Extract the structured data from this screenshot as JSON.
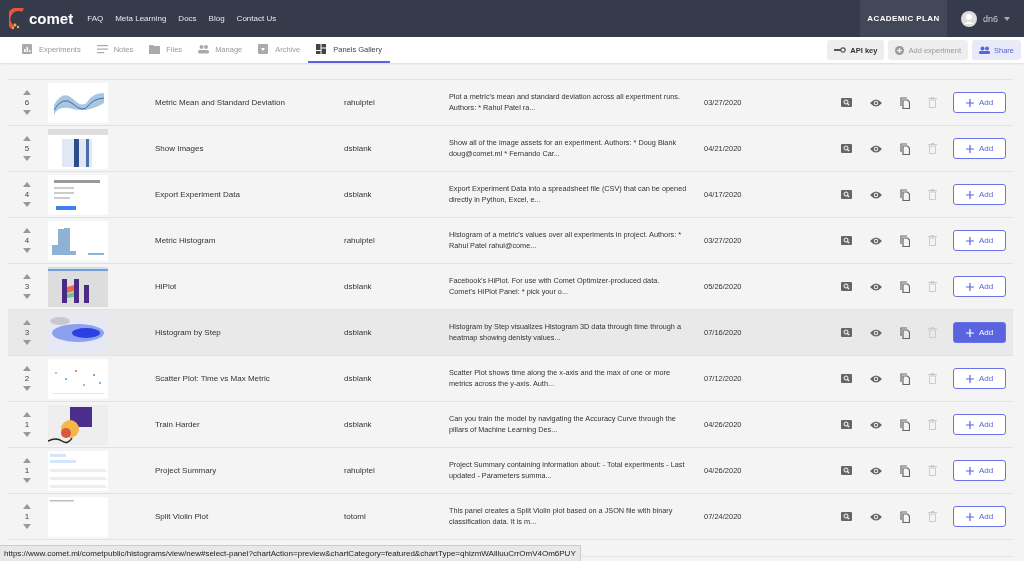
{
  "header": {
    "logo": "comet",
    "nav": [
      "FAQ",
      "Meta Learning",
      "Docs",
      "Blog",
      "Contact Us"
    ],
    "plan": "ACADEMIC PLAN",
    "user": "dn6"
  },
  "tabs": [
    {
      "label": "Experiments",
      "selected": false
    },
    {
      "label": "Notes",
      "selected": false
    },
    {
      "label": "Files",
      "selected": false
    },
    {
      "label": "Manage",
      "selected": false
    },
    {
      "label": "Archive",
      "selected": false
    },
    {
      "label": "Panels Gallery",
      "selected": true
    }
  ],
  "toolbar": {
    "api_key": "API key",
    "add_experiment": {
      "label": "Add experiment",
      "disabled": true
    },
    "share": "Share"
  },
  "panels": [
    {
      "votes": "6",
      "name": "Metric Mean and Standard Deviation",
      "author": "rahulptel",
      "description": "Plot a metric's mean and standard deviation across all experiment runs. Authors: * Rahul Patel ra...",
      "date": "03/27/2020",
      "add": "Add",
      "selected": false
    },
    {
      "votes": "5",
      "name": "Show Images",
      "author": "dsblank",
      "description": "Show all of the image assets for an experiment. Authors: * Doug Blank doug@comet.ml * Fernando Car...",
      "date": "04/21/2020",
      "add": "Add",
      "selected": false
    },
    {
      "votes": "4",
      "name": "Export Experiment Data",
      "author": "dsblank",
      "description": "Export Experiment Data into a spreadsheet file (CSV) that can be opened directly in Python, Excel, e...",
      "date": "04/17/2020",
      "add": "Add",
      "selected": false
    },
    {
      "votes": "4",
      "name": "Metric Histogram",
      "author": "rahulptel",
      "description": "Histogram of a metric's values over all experiments in project. Authors: * Rahul Patel rahul@come...",
      "date": "03/27/2020",
      "add": "Add",
      "selected": false
    },
    {
      "votes": "3",
      "name": "HiPlot",
      "author": "dsblank",
      "description": "Facebook's HiPlot. For use with Comet Optimizer-produced data. Comet's HiPlot Panel: * pick your o...",
      "date": "05/26/2020",
      "add": "Add",
      "selected": false
    },
    {
      "votes": "3",
      "name": "Histogram by Step",
      "author": "dsblank",
      "description": "Histogram by Step visualizes Histogram 3D data through time through a heatmap showing denisty values...",
      "date": "07/16/2020",
      "add": "Add",
      "selected": true
    },
    {
      "votes": "2",
      "name": "Scatter Plot: Time vs Max Metric",
      "author": "dsblank",
      "description": "Scatter Plot shows time along the x-axis and the max of one or more metrics across the y-axis. Auth...",
      "date": "07/12/2020",
      "add": "Add",
      "selected": false
    },
    {
      "votes": "1",
      "name": "Train Harder",
      "author": "dsblank",
      "description": "Can you train the model by navigating the Accuracy Curve through the pillars of Machine Learning Des...",
      "date": "04/26/2020",
      "add": "Add",
      "selected": false
    },
    {
      "votes": "1",
      "name": "Project Summary",
      "author": "rahulptel",
      "description": "Project Summary containing information about: - Total experiments - Last updated - Parameters summa...",
      "date": "04/26/2020",
      "add": "Add",
      "selected": false
    },
    {
      "votes": "1",
      "name": "Split Violin Plot",
      "author": "totoml",
      "description": "This panel creates a Split Violin plot based on a JSON file with binary classification data. It is m...",
      "date": "07/24/2020",
      "add": "Add",
      "selected": false
    }
  ],
  "status_url": "https://www.comet.ml/cometpublic/histograms/view/new#select-panel?chartAction=preview&chartCategory=featured&chartType=qhizmWAllluuCrrOmV4Om6PUY"
}
